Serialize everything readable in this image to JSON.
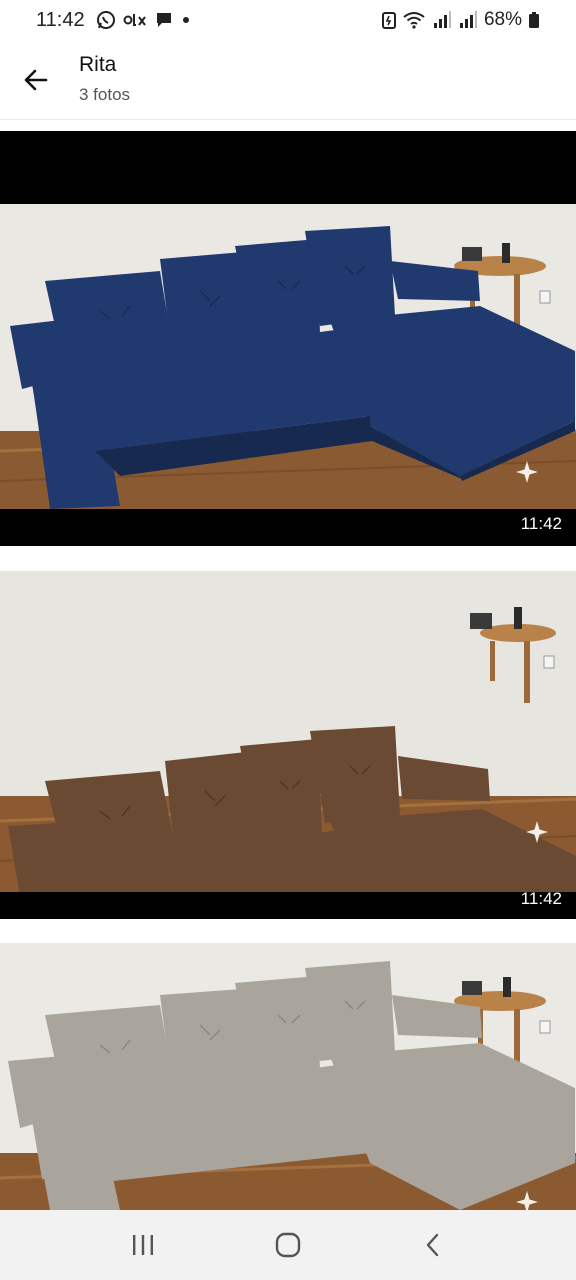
{
  "status_bar": {
    "time": "11:42",
    "battery": "68%",
    "left_icons": [
      "whatsapp-icon",
      "olx-icon",
      "chat-icon",
      "dot-icon"
    ],
    "right_icons": [
      "battery-saver-icon",
      "wifi-icon",
      "signal-icon",
      "signal-icon",
      "battery-icon"
    ]
  },
  "header": {
    "title": "Rita",
    "subtitle": "3 fotos",
    "back_icon": "arrow-left-icon"
  },
  "photos": [
    {
      "time": "11:42",
      "sofa_color": "#203a6f",
      "icon": "sparkle-icon"
    },
    {
      "time": "11:42",
      "sofa_color": "#6b4a33",
      "icon": "sparkle-icon"
    },
    {
      "sofa_color": "#a9a59d",
      "icon": "sparkle-icon"
    }
  ],
  "nav_bar": {
    "icons": [
      "recent-apps-icon",
      "home-icon",
      "back-icon"
    ]
  }
}
